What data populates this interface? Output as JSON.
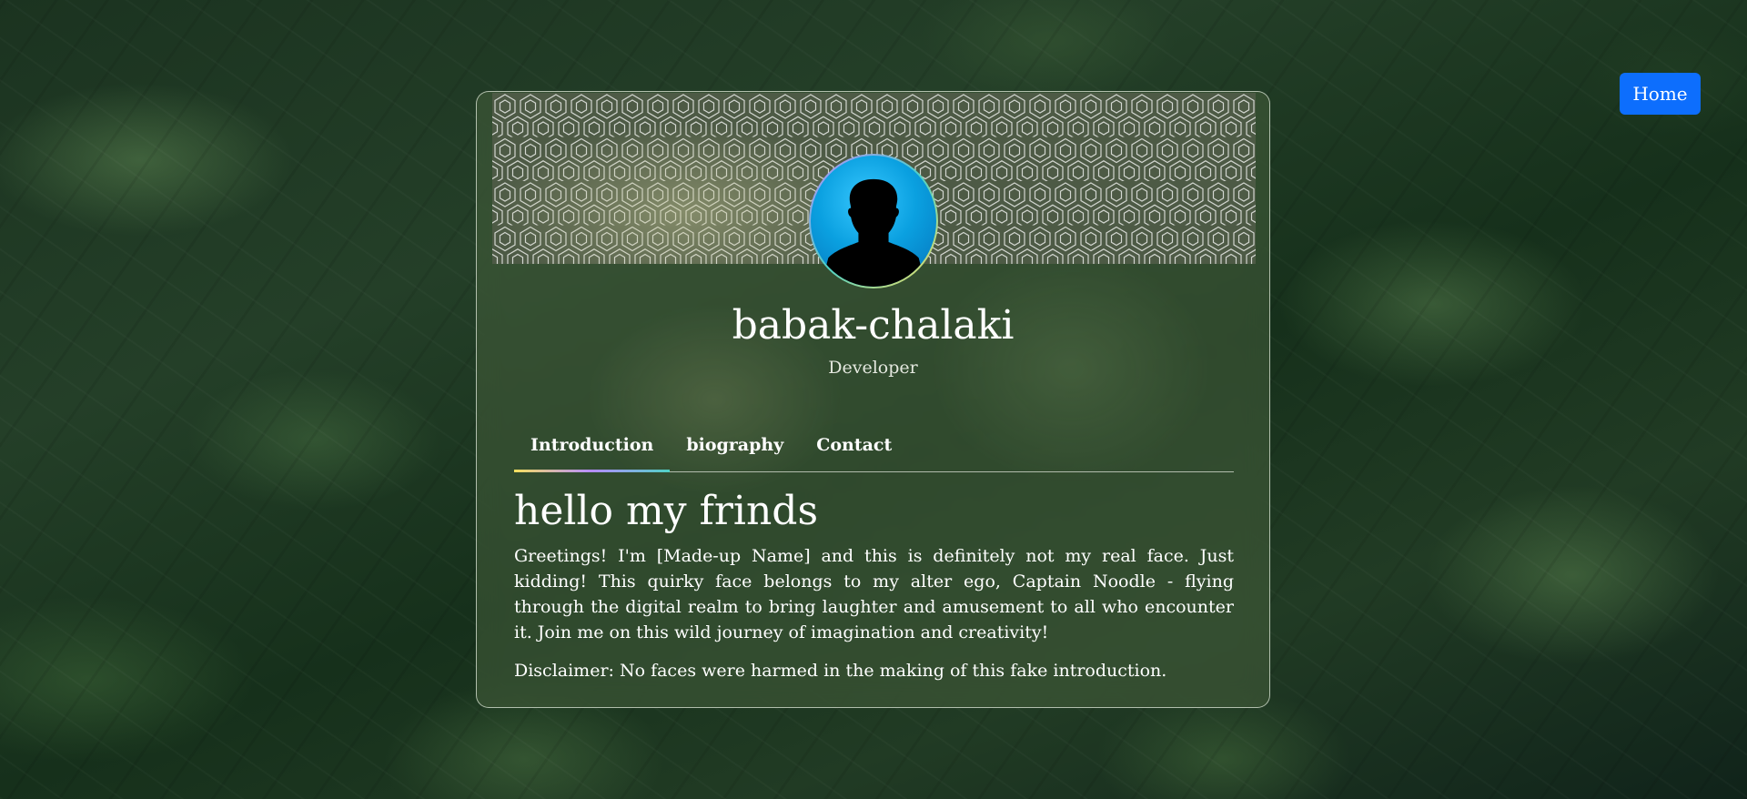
{
  "nav": {
    "home_label": "Home"
  },
  "profile": {
    "name": "babak-chalaki",
    "role": "Developer"
  },
  "tabs": [
    {
      "label": "Introduction",
      "active": true
    },
    {
      "label": "biography",
      "active": false
    },
    {
      "label": "Contact",
      "active": false
    }
  ],
  "intro": {
    "heading": "hello my frinds",
    "paragraph": "Greetings! I'm [Made-up Name] and this is definitely not my real face. Just kidding! This quirky face belongs to my alter ego, Captain Noodle - flying through the digital realm to bring laughter and amusement to all who encounter it. Join me on this wild journey of imagination and creativity!",
    "disclaimer": "Disclaimer: No faces were harmed in the making of this fake introduction."
  },
  "colors": {
    "home_button": "#0d6efd",
    "avatar_bg": "#0aa0e0",
    "text": "#ffffff"
  },
  "icons": {
    "avatar": "person-silhouette-icon"
  }
}
